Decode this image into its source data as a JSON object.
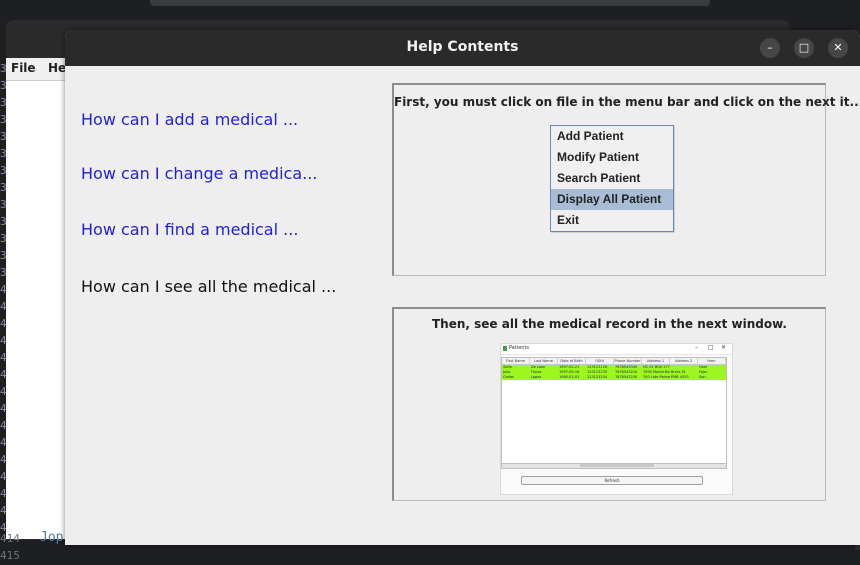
{
  "background_window": {
    "menu": [
      "File",
      "He"
    ],
    "gutter_digits": [
      "3",
      "3",
      "3",
      "3",
      "3",
      "3",
      "3",
      "3",
      "3",
      "3",
      "3",
      "3",
      "3",
      "4",
      "4",
      "4",
      "4",
      "4",
      "4",
      "4",
      "4",
      "4",
      "4",
      "4",
      "4",
      "4",
      "4",
      "4",
      "4"
    ],
    "bottom_line_numbers": [
      "414",
      "415"
    ],
    "code_fragment": "Jop"
  },
  "window": {
    "title": "Help Contents",
    "controls": {
      "minimize": "–",
      "maximize": "□",
      "close": "✕"
    }
  },
  "topics": [
    {
      "label": "How can I add a medical ...",
      "active": false
    },
    {
      "label": "How can I change a medica...",
      "active": false
    },
    {
      "label": "How can I find a medical ...",
      "active": false
    },
    {
      "label": "How can I see all the medical ...",
      "active": true
    }
  ],
  "panel1": {
    "caption": "First, you must click on file  in the menu bar and click on the next it...",
    "menu_items": [
      {
        "label": "Add Patient",
        "selected": false
      },
      {
        "label": "Modify Patient",
        "selected": false
      },
      {
        "label": "Search Patient",
        "selected": false
      },
      {
        "label": "Display All Patient",
        "selected": true
      },
      {
        "label": "Exit",
        "selected": false
      }
    ]
  },
  "panel2": {
    "caption": "Then, see all the medical record in the next window.",
    "mini_window": {
      "title": "Patients",
      "columns": [
        "First Name",
        "Last Name",
        "Date of Birth",
        "OSHI",
        "Phone Number",
        "Address 1",
        "Address 2",
        "Hom"
      ],
      "rows": [
        [
          "Sofia",
          "De Leon",
          "1997-02-21",
          "123123126",
          "7876543340",
          "HC 01 BOX 17709",
          "",
          "Hom"
        ],
        [
          "Julio",
          "Flores",
          "1997-09-16",
          "123123230",
          "7876543210",
          "1990 Monte Bello II",
          "Brent St",
          "Fajar"
        ],
        [
          "Carlos",
          "Lopez",
          "1980-01-01",
          "123123234",
          "7876543230",
          "350 Late Palmeras",
          "PMB 4553",
          "San"
        ]
      ],
      "button_label": "Refresh"
    }
  },
  "colors": {
    "link": "#1f1fd6",
    "menu_selected": "#a8bdd5",
    "row_highlight": "#9bf71e"
  }
}
